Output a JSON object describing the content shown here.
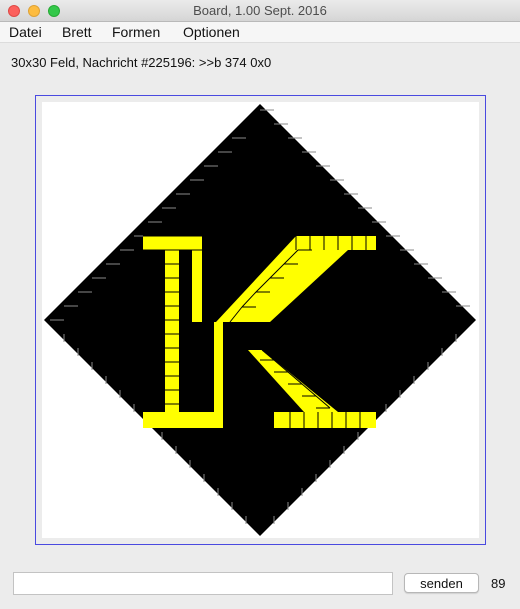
{
  "window": {
    "title": "Board, 1.00 Sept. 2016",
    "controls": [
      "close",
      "minimize",
      "zoom"
    ]
  },
  "menu": {
    "items": [
      "Datei",
      "Brett",
      "Formen",
      "Optionen"
    ]
  },
  "status": {
    "text": "30x30 Feld, Nachricht #225196: >>b 374 0x0"
  },
  "board": {
    "grid_size": 30,
    "background_color": "#000000",
    "highlight_color": "#ffff00",
    "border_color": "#4a4ae0"
  },
  "input": {
    "value": "",
    "placeholder": ""
  },
  "send_button": {
    "label": "senden"
  },
  "counter": {
    "value": "89"
  }
}
